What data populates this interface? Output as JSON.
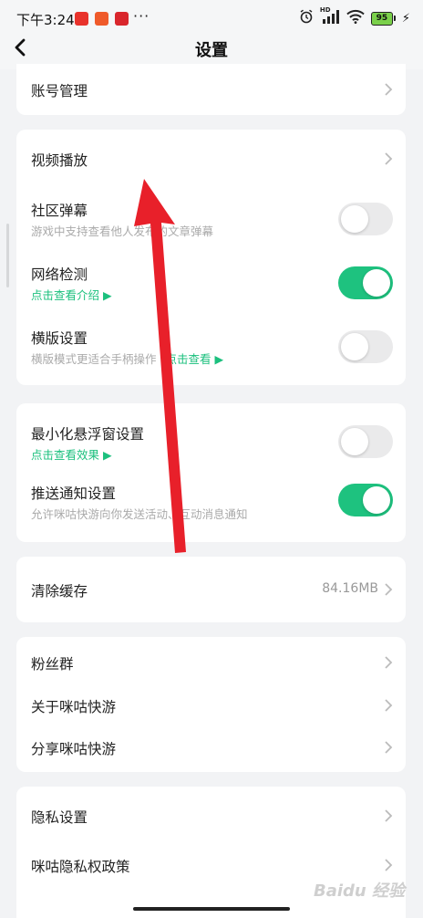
{
  "status_bar": {
    "time": "下午3:24",
    "more": "···",
    "battery": "95",
    "network": "HD"
  },
  "header": {
    "title": "设置"
  },
  "sections": {
    "account": {
      "label": "账号管理"
    },
    "video": {
      "label": "视频播放"
    },
    "danmaku": {
      "label": "社区弹幕",
      "sub": "游戏中支持查看他人发布的文章弹幕",
      "on": false
    },
    "network": {
      "label": "网络检测",
      "link": "点击查看介绍 ▶",
      "on": true
    },
    "landscape": {
      "label": "横版设置",
      "sub": "横版模式更适合手柄操作",
      "link": "点击查看 ▶",
      "on": false
    },
    "float_window": {
      "label": "最小化悬浮窗设置",
      "link": "点击查看效果 ▶",
      "on": false
    },
    "push": {
      "label": "推送通知设置",
      "sub": "允许咪咕快游向你发送活动、互动消息通知",
      "on": true
    },
    "cache": {
      "label": "清除缓存",
      "value": "84.16MB"
    },
    "fans": {
      "label": "粉丝群"
    },
    "about": {
      "label": "关于咪咕快游"
    },
    "share": {
      "label": "分享咪咕快游"
    },
    "privacy_settings": {
      "label": "隐私设置"
    },
    "privacy_policy": {
      "label": "咪咕隐私权政策"
    }
  },
  "watermark": "Baidu 经验",
  "colors": {
    "accent": "#1ec27f",
    "link": "#1cc07e",
    "arrow": "#e8202a"
  }
}
